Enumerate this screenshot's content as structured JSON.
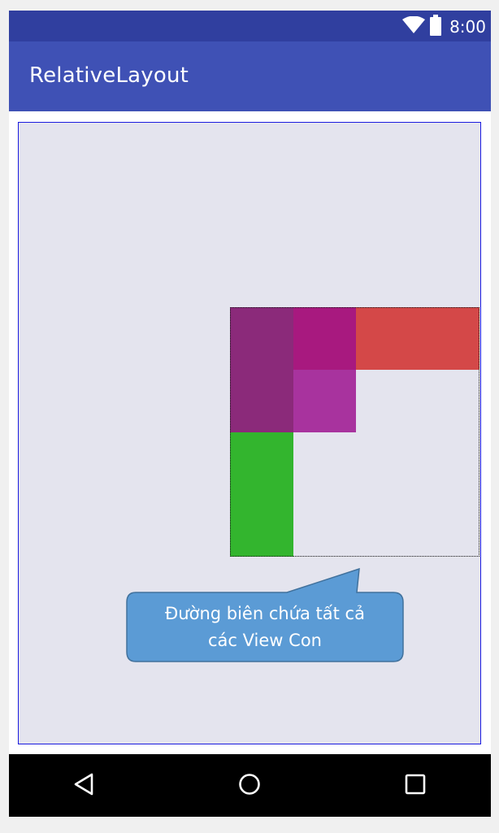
{
  "status_bar": {
    "time": "8:00",
    "icons": [
      "wifi-icon",
      "battery-icon"
    ]
  },
  "app_bar": {
    "title": "RelativeLayout"
  },
  "layout": {
    "background": "#e4e4ee",
    "border_color": "#1a1adf",
    "blocks": [
      {
        "name": "view-purple-tall",
        "color": "#8b2a7a"
      },
      {
        "name": "view-magenta-top",
        "color": "#a8197f"
      },
      {
        "name": "view-red-wide",
        "color": "#d44848"
      },
      {
        "name": "view-light-magenta",
        "color": "#a8339e"
      },
      {
        "name": "view-green",
        "color": "#33b52e"
      }
    ]
  },
  "callout": {
    "line1": "Đường biên chứa tất cả",
    "line2": "các View Con",
    "fill": "#5b9bd5",
    "stroke": "#41719c"
  },
  "nav_bar": {
    "icons": [
      "back-icon",
      "home-icon",
      "recents-icon"
    ]
  }
}
